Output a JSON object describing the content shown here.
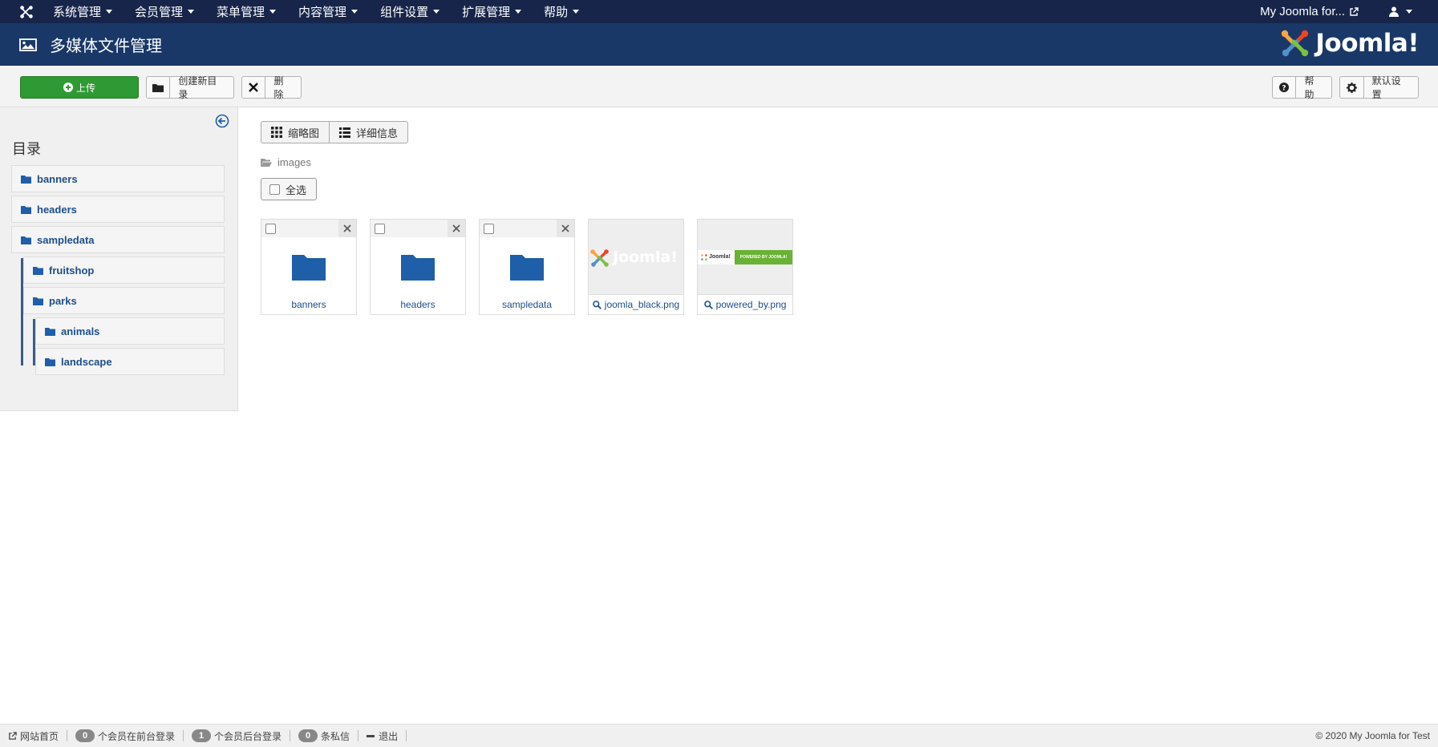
{
  "navbar": {
    "menus": [
      "系统管理",
      "会员管理",
      "菜单管理",
      "内容管理",
      "组件设置",
      "扩展管理",
      "帮助"
    ],
    "site_link": "My Joomla for..."
  },
  "header": {
    "title": "多媒体文件管理",
    "logo_text": "Joomla!"
  },
  "toolbar": {
    "upload": "上传",
    "new_folder": "创建新目录",
    "delete": "删除",
    "help": "帮助",
    "options": "默认设置"
  },
  "sidebar": {
    "heading": "目录",
    "items": [
      {
        "label": "banners"
      },
      {
        "label": "headers"
      },
      {
        "label": "sampledata"
      },
      {
        "label": "fruitshop"
      },
      {
        "label": "parks"
      },
      {
        "label": "animals"
      },
      {
        "label": "landscape"
      }
    ]
  },
  "main": {
    "view_thumbs": "缩略图",
    "view_details": "详细信息",
    "breadcrumb": "images",
    "select_all": "全选",
    "folders": [
      {
        "name": "banners"
      },
      {
        "name": "headers"
      },
      {
        "name": "sampledata"
      }
    ],
    "images": [
      {
        "name": "joomla_black.png"
      },
      {
        "name": "powered_by.png"
      }
    ],
    "powered_badge": "POWERED BY JOOMLA!",
    "powered_logo": "Joomla!"
  },
  "footer": {
    "site": "网站首页",
    "frontend_count": "0",
    "frontend_label": "个会员在前台登录",
    "backend_count": "1",
    "backend_label": "个会员后台登录",
    "messages_count": "0",
    "messages_label": "条私信",
    "logout": "退出",
    "copyright": "© 2020 My Joomla for Test"
  },
  "colors": {
    "navbar": "#17254a",
    "header": "#1a3867",
    "upload_button": "#2f9a33",
    "folder_icon": "#1f5ea8",
    "link": "#1d4e8a"
  }
}
